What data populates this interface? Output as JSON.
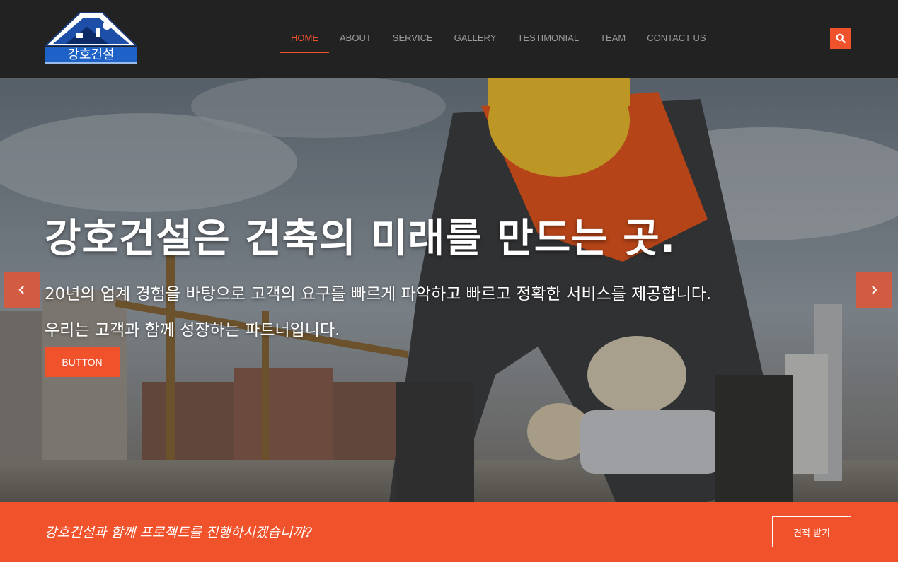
{
  "brand": {
    "logo_text": "강호건설",
    "colors": {
      "accent": "#f0522c",
      "header_bg": "#222222",
      "logo_blue": "#1e62c8"
    }
  },
  "nav": {
    "items": [
      {
        "label": "HOME",
        "active": true
      },
      {
        "label": "ABOUT"
      },
      {
        "label": "SERVICE"
      },
      {
        "label": "GALLERY"
      },
      {
        "label": "TESTIMONIAL"
      },
      {
        "label": "TEAM"
      },
      {
        "label": "CONTACT US"
      }
    ],
    "search_icon": "search-icon"
  },
  "hero": {
    "title": "강호건설은 건축의 미래를 만드는 곳.",
    "subtitle_line1": "20년의 업계 경험을 바탕으로 고객의 요구를 빠르게 파악하고 빠르고 정확한 서비스를 제공합니다.",
    "subtitle_line2": "우리는 고객과 함께 성장하는 파트너입니다.",
    "button_label": "BUTTON",
    "prev_icon": "chevron-left-icon",
    "next_icon": "chevron-right-icon"
  },
  "cta": {
    "text": "강호건설과 함께 프로젝트를 진행하시겠습니까?",
    "button_label": "견적 받기"
  }
}
